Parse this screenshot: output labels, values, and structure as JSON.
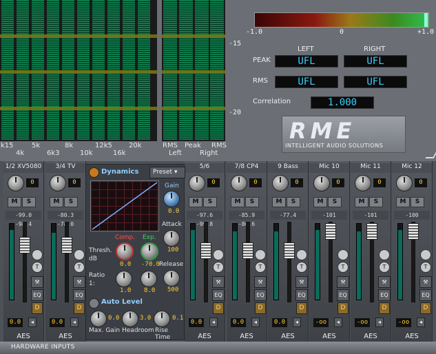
{
  "analyzer": {
    "freq_top": [
      "k15",
      "5k",
      "8k",
      "12k5",
      "20k"
    ],
    "freq_bottom": [
      "4k",
      "6k3",
      "10k",
      "16k"
    ],
    "rms_labels": [
      "RMS",
      "Peak",
      "RMS"
    ],
    "channel_labels": [
      "Left",
      "Right"
    ],
    "db_marks": [
      "-15",
      "-20"
    ]
  },
  "meter_panel": {
    "scale": [
      "-1.0",
      "0",
      "+1.0"
    ],
    "col_left": "LEFT",
    "col_right": "RIGHT",
    "peak_label": "PEAK",
    "rms_label": "RMS",
    "peak_left": "UFL",
    "peak_right": "UFL",
    "rms_left": "UFL",
    "rms_right": "UFL",
    "correlation_label": "Correlation",
    "correlation_value": "1.000"
  },
  "logo": {
    "big": "RME",
    "small": "INTELLIGENT AUDIO SOLUTIONS"
  },
  "strips": [
    {
      "name": "1/2 XV5080",
      "gain": "0",
      "peak": "-99.0 -98.4",
      "vol": "0.0",
      "route": "AES"
    },
    {
      "name": "3/4 TV",
      "gain": "0",
      "peak": "-80.3 -78.0",
      "vol": "0.0",
      "route": "AES"
    },
    {
      "name": "5/6",
      "gain": "0",
      "peak": "-97.6 -99.8",
      "vol": "0.0",
      "route": "AES"
    },
    {
      "name": "7/8 CP4",
      "gain": "0",
      "peak": "-85.9 -86.6",
      "vol": "0.0",
      "route": "AES"
    },
    {
      "name": "9 Bass",
      "gain": "0",
      "peak": "-77.4",
      "vol": "0.0",
      "route": "AES"
    },
    {
      "name": "Mic 10",
      "gain": "0",
      "peak": "-101",
      "vol": "-oo",
      "route": "AES"
    },
    {
      "name": "Mic 11",
      "gain": "0",
      "peak": "-101",
      "vol": "-oo",
      "route": "AES"
    },
    {
      "name": "Mic 12",
      "gain": "0",
      "peak": "-100",
      "vol": "-oo",
      "route": "AES"
    }
  ],
  "buttons": {
    "m": "M",
    "s": "S",
    "t": "T",
    "eq": "EQ",
    "d": "D"
  },
  "dynamics": {
    "title": "Dynamics",
    "preset": "Preset",
    "gain_label": "Gain",
    "gain_value": "0.0",
    "attack_label": "Attack",
    "attack_value": "100",
    "release_label": "Release",
    "release_value": "500",
    "thresh_label": "Thresh.",
    "thresh_unit": "dB",
    "comp_label": "Comp.",
    "exp_label": "Exp.",
    "comp_value": "0.0",
    "exp_value": "-70.0",
    "ratio_label": "Ratio",
    "ratio_unit": "1:",
    "ratio_comp": "1.0",
    "ratio_exp": "8.0",
    "autolevel_label": "Auto Level",
    "maxgain_label": "Max. Gain",
    "maxgain_value": "0.0",
    "headroom_label": "Headroom",
    "headroom_value": "3.0",
    "risetime_label": "Rise Time",
    "risetime_value": "0.1"
  },
  "hardware_inputs": "HARDWARE INPUTS"
}
